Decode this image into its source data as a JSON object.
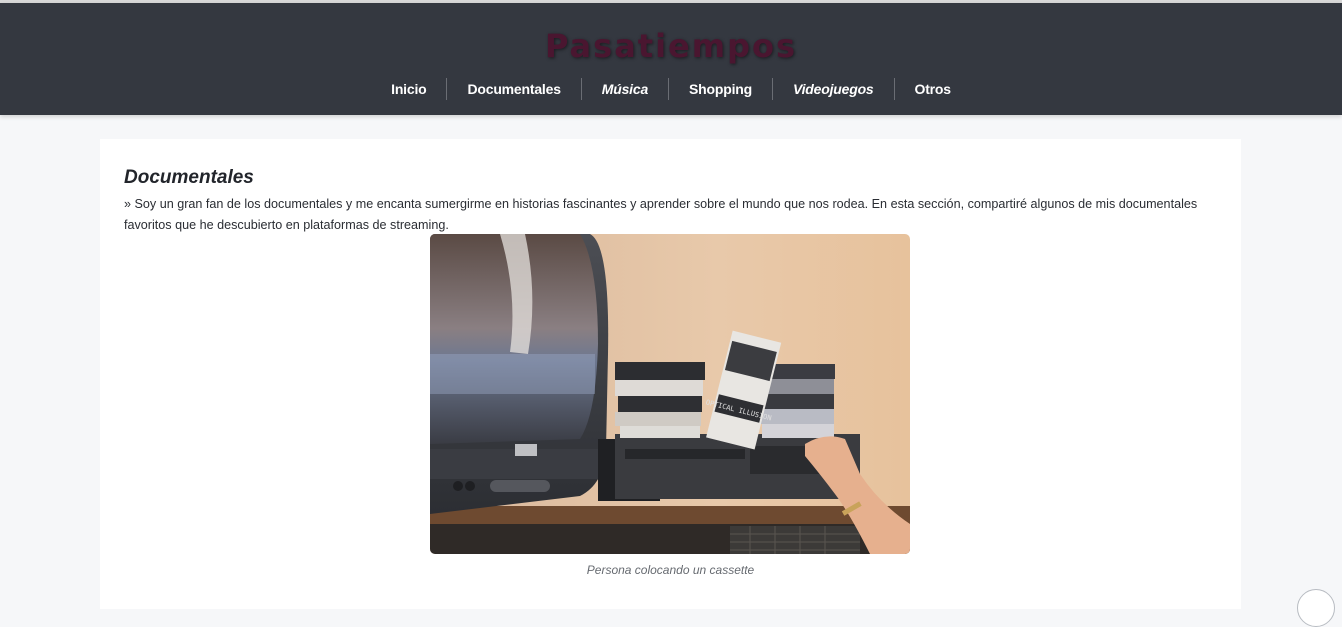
{
  "site": {
    "title": "Pasatiempos"
  },
  "nav": {
    "items": [
      {
        "label": "Inicio"
      },
      {
        "label": "Documentales"
      },
      {
        "label": "Música"
      },
      {
        "label": "Shopping"
      },
      {
        "label": "Videojuegos"
      },
      {
        "label": "Otros"
      }
    ]
  },
  "main": {
    "section_title": "Documentales",
    "intro": "» Soy un gran fan de los documentales y me encanta sumergirme en historias fascinantes y aprender sobre el mundo que nos rodea. En esta sección, compartiré algunos de mis documentales favoritos que he descubierto en plataformas de streaming.",
    "figure": {
      "caption": "Persona colocando un cassette",
      "cassette_labels": [
        "OPTICAL ILLUSION"
      ]
    }
  },
  "colors": {
    "header_bg": "#343840",
    "title_color": "#4a1630",
    "page_bg": "#f6f7f9",
    "card_bg": "#ffffff"
  },
  "icons": {
    "scroll": "scroll-to-top-icon"
  }
}
